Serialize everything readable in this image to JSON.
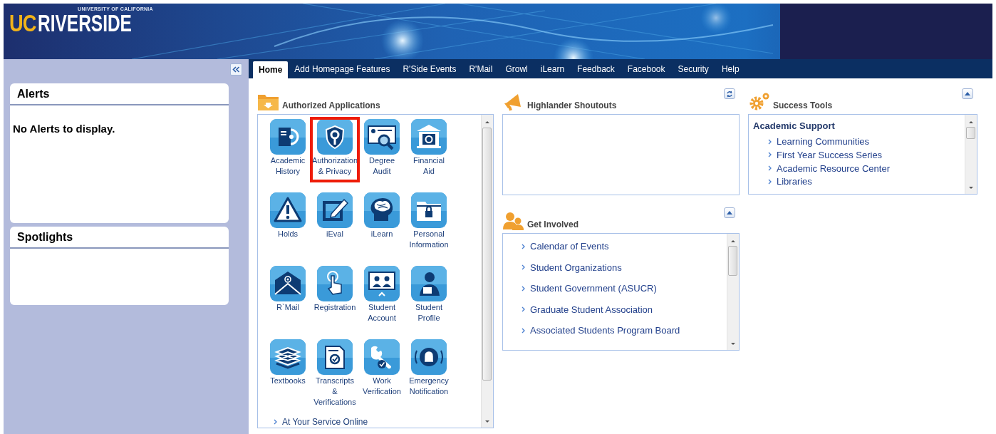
{
  "banner": {
    "logo_prefix": "UC",
    "logo_name": "RIVERSIDE",
    "logo_tagline": "UNIVERSITY OF CALIFORNIA"
  },
  "sidebar": {
    "panels": [
      {
        "title": "Alerts",
        "message": "No Alerts to display."
      },
      {
        "title": "Spotlights"
      }
    ]
  },
  "nav": {
    "tabs": [
      {
        "label": "Home",
        "selected": true
      },
      {
        "label": "Add Homepage Features",
        "selected": false
      },
      {
        "label": "R'Side Events",
        "selected": false
      },
      {
        "label": "R'Mail",
        "selected": false
      },
      {
        "label": "Growl",
        "selected": false
      },
      {
        "label": "iLearn",
        "selected": false
      },
      {
        "label": "Feedback",
        "selected": false
      },
      {
        "label": "Facebook",
        "selected": false
      },
      {
        "label": "Security",
        "selected": false
      },
      {
        "label": "Help",
        "selected": false
      }
    ]
  },
  "authorized_applications": {
    "title": "Authorized Applications",
    "apps": [
      {
        "label": "Academic History",
        "highlighted": false
      },
      {
        "label": "Authorization & Privacy",
        "highlighted": true
      },
      {
        "label": "Degree Audit",
        "highlighted": false
      },
      {
        "label": "Financial Aid",
        "highlighted": false
      },
      {
        "label": "Holds",
        "highlighted": false
      },
      {
        "label": "iEval",
        "highlighted": false
      },
      {
        "label": "iLearn",
        "highlighted": false
      },
      {
        "label": "Personal Information",
        "highlighted": false
      },
      {
        "label": "R`Mail",
        "highlighted": false
      },
      {
        "label": "Registration",
        "highlighted": false
      },
      {
        "label": "Student Account",
        "highlighted": false
      },
      {
        "label": "Student Profile",
        "highlighted": false
      },
      {
        "label": "Textbooks",
        "highlighted": false
      },
      {
        "label": "Transcripts & Verifications",
        "highlighted": false
      },
      {
        "label": "Work Verification",
        "highlighted": false
      },
      {
        "label": "Emergency Notification",
        "highlighted": false
      }
    ],
    "more_link": "At Your Service Online"
  },
  "highlander_shoutouts": {
    "title": "Highlander Shoutouts"
  },
  "get_involved": {
    "title": "Get Involved",
    "links": [
      "Calendar of Events",
      "Student Organizations",
      "Student Government (ASUCR)",
      "Graduate Student Association",
      "Associated Students Program Board"
    ]
  },
  "success_tools": {
    "title": "Success Tools",
    "sections": [
      {
        "heading": "Academic Support",
        "links": [
          "Learning Communities",
          "First Year Success Series",
          "Academic Resource Center",
          "Libraries"
        ]
      }
    ]
  }
}
